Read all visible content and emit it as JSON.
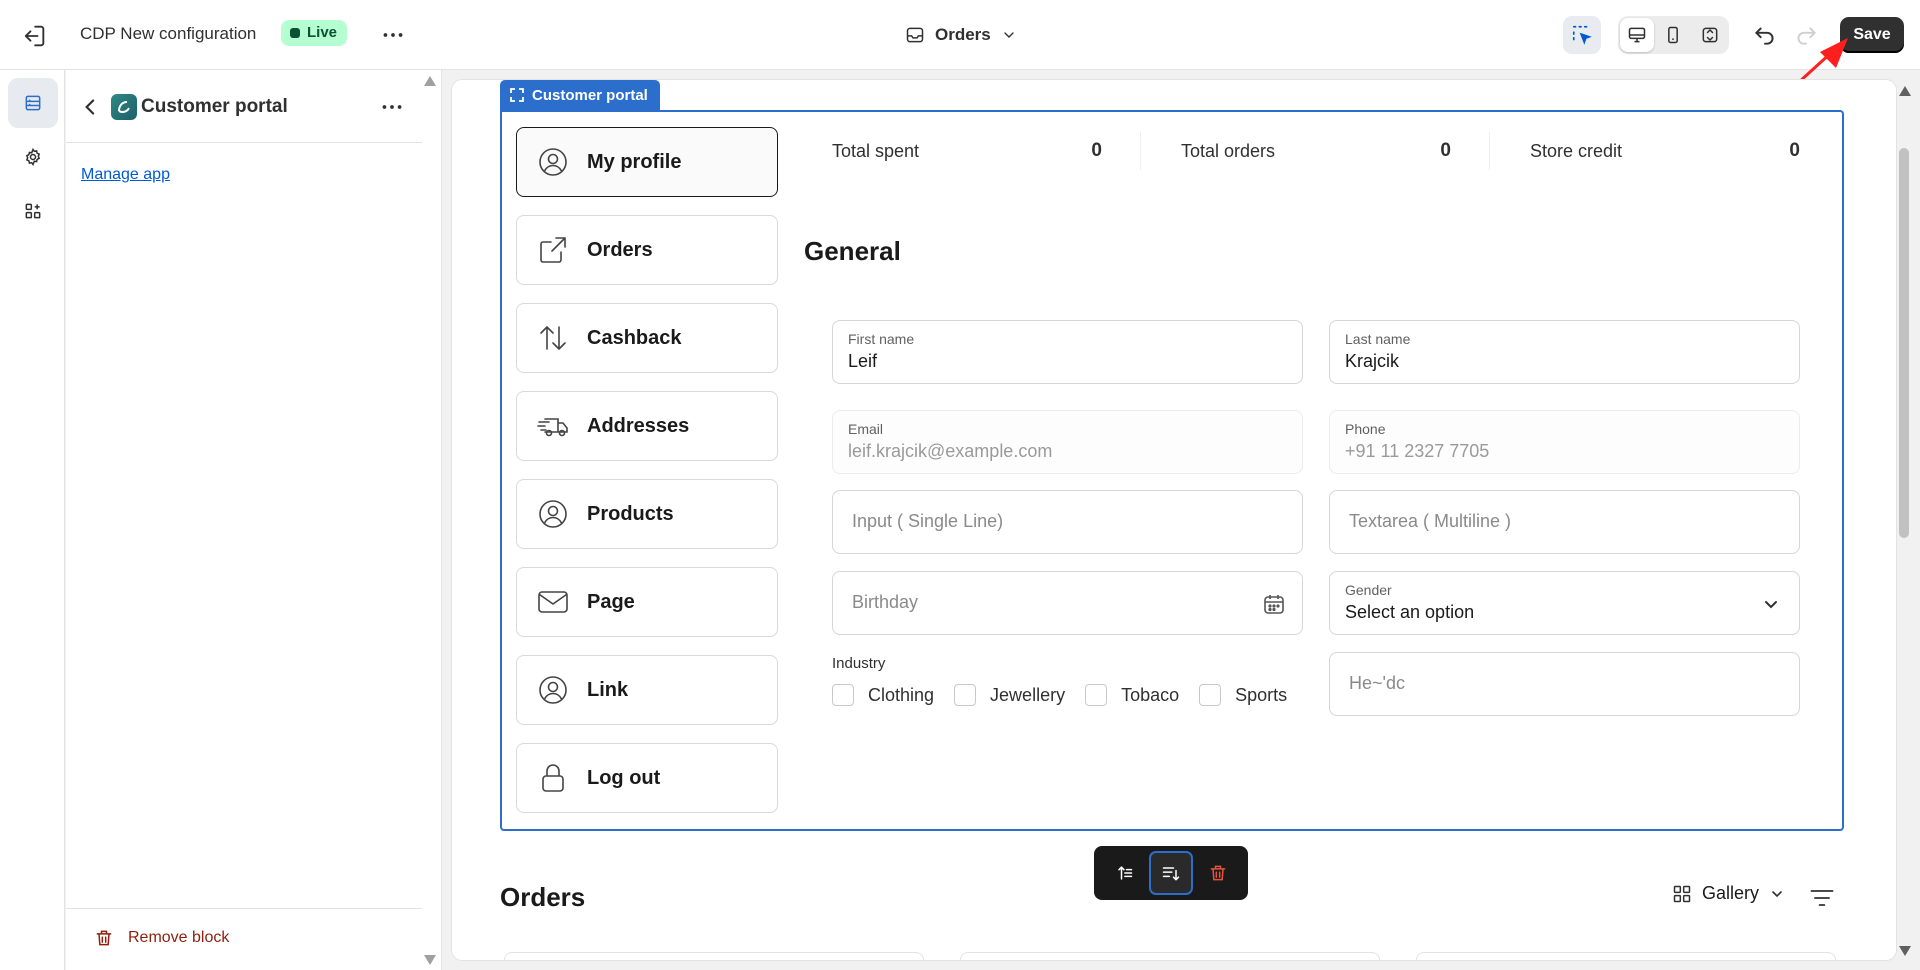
{
  "topbar": {
    "app_title": "CDP New configuration",
    "status_badge": "Live",
    "template_name": "Orders",
    "save_label": "Save"
  },
  "panel": {
    "title": "Customer portal",
    "manage_link": "Manage app",
    "remove_label": "Remove block"
  },
  "block": {
    "label": "Customer portal"
  },
  "portal": {
    "nav": [
      {
        "label": "My profile",
        "icon": "user-circle-icon"
      },
      {
        "label": "Orders",
        "icon": "external-link-icon"
      },
      {
        "label": "Cashback",
        "icon": "arrows-up-down-icon"
      },
      {
        "label": "Addresses",
        "icon": "delivery-truck-icon"
      },
      {
        "label": "Products",
        "icon": "user-circle-icon"
      },
      {
        "label": "Page",
        "icon": "envelope-icon"
      },
      {
        "label": "Link",
        "icon": "user-circle-icon"
      },
      {
        "label": "Log out",
        "icon": "lock-icon"
      }
    ],
    "stats": [
      {
        "label": "Total spent",
        "value": "0"
      },
      {
        "label": "Total orders",
        "value": "0"
      },
      {
        "label": "Store credit",
        "value": "0"
      }
    ],
    "section_title": "General",
    "fields": {
      "first_name": {
        "label": "First name",
        "value": "Leif"
      },
      "last_name": {
        "label": "Last name",
        "value": "Krajcik"
      },
      "email": {
        "label": "Email",
        "value": "leif.krajcik@example.com"
      },
      "phone": {
        "label": "Phone",
        "value": "+91 11 2327 7705"
      },
      "single_line": {
        "placeholder": "Input ( Single  Line)"
      },
      "multiline": {
        "placeholder": "Textarea (  Multiline )"
      },
      "birthday": {
        "placeholder": "Birthday"
      },
      "gender": {
        "label": "Gender",
        "value": "Select an option"
      },
      "extra": {
        "placeholder": "He~'dc"
      }
    },
    "industry": {
      "label": "Industry",
      "options": [
        "Clothing",
        "Jewellery",
        "Tobaco",
        "Sports"
      ]
    }
  },
  "orders_section": {
    "title": "Orders",
    "view_label": "Gallery"
  },
  "colors": {
    "accent": "#2c6ecb",
    "live_badge_bg": "#b4fed2",
    "save_bg": "#303030",
    "annotation": "#ff1f1f",
    "danger": "#8e1f0b"
  }
}
